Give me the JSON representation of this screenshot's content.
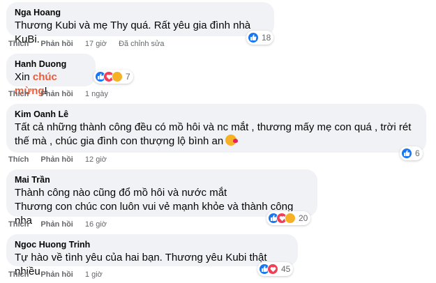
{
  "comments": [
    {
      "author": "Nga Hoang",
      "text": "Thương Kubi và mẹ Thy quá. Rất yêu gia đình nhà KuBi.",
      "like": "Thích",
      "reply": "Phản hồi",
      "time": "17 giờ",
      "edited": "Đã chỉnh sửa",
      "count": "18"
    },
    {
      "author": "Hanh Duong",
      "text_before": "Xin ",
      "text_highlight": "chúc mừng",
      "text_after": "!",
      "like": "Thích",
      "reply": "Phản hồi",
      "time": "1 ngày",
      "count": "7"
    },
    {
      "author": "Kim Oanh Lê",
      "line1": "Tất cả những thành công đều có mồ hôi và nc mắt , thương mấy mẹ con quá , trời rét",
      "line2": "thế mà , chúc gia đình con thượng lộ bình an",
      "like": "Thích",
      "reply": "Phản hồi",
      "time": "12 giờ",
      "count": "6"
    },
    {
      "author": "Mai Trần",
      "line1": "Thành công nào cũng đổ mồ hôi và nước mắt",
      "line2": "Thương con chúc con luôn vui vẻ mạnh khỏe và thành công nha",
      "like": "Thích",
      "reply": "Phản hồi",
      "time": "16 giờ",
      "count": "20"
    },
    {
      "author": "Ngoc Huong Trinh",
      "text": "Tự hào về tình yêu của hai bạn. Thương yêu Kubi thật nhiều.",
      "like": "Thích",
      "reply": "Phản hồi",
      "time": "1 giờ",
      "count": "45"
    }
  ],
  "icons": {
    "like": "like-reaction-icon",
    "love": "love-reaction-icon",
    "care": "care-reaction-icon"
  },
  "colors": {
    "bubble": "#f0f2f5",
    "like": "#1877f2",
    "love": "#f33e58",
    "care": "#f7b125",
    "highlight": "#e85c3a"
  }
}
